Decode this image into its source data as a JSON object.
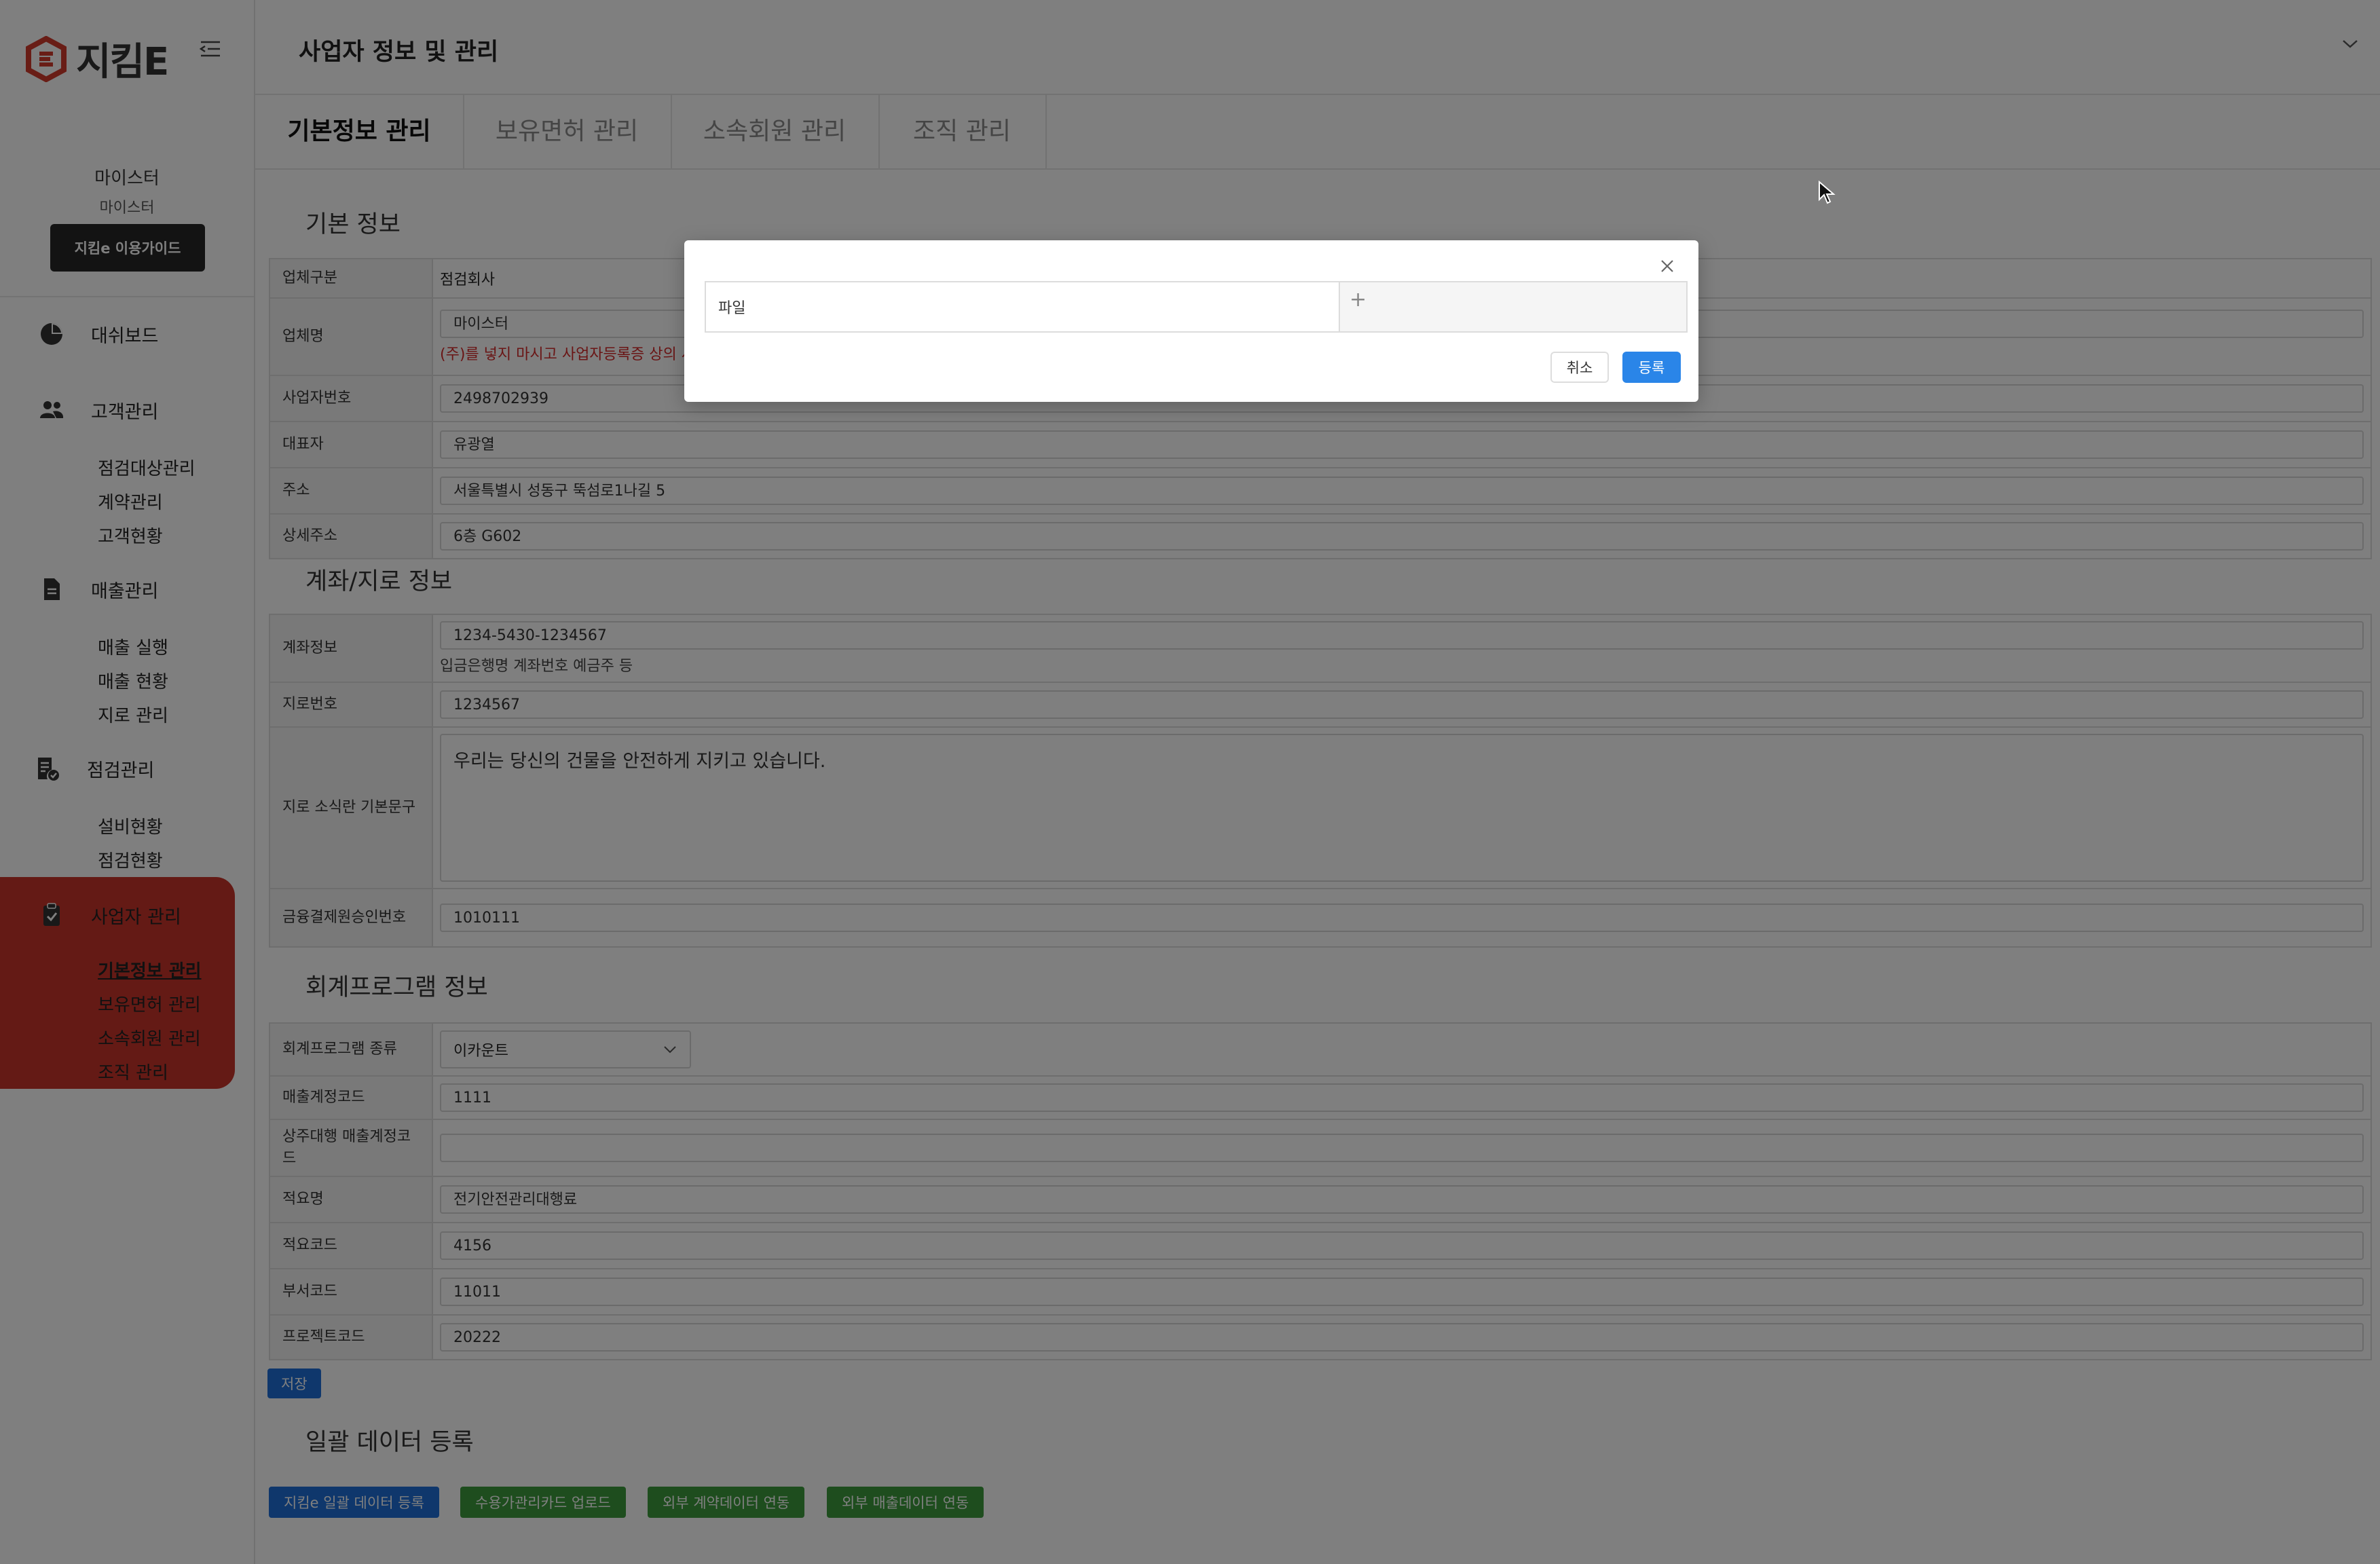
{
  "app": {
    "logo_text": "지킴E",
    "page_title": "사업자 정보 및 관리"
  },
  "sidebar": {
    "user_name": "마이스터",
    "user_role": "마이스터",
    "guide_button": "지킴e 이용가이드",
    "sections": [
      {
        "label": "대쉬보드",
        "icon": "pie-chart-icon",
        "items": []
      },
      {
        "label": "고객관리",
        "icon": "users-icon",
        "items": [
          "점검대상관리",
          "계약관리",
          "고객현황"
        ]
      },
      {
        "label": "매출관리",
        "icon": "document-icon",
        "items": [
          "매출 실행",
          "매출 현황",
          "지로 관리"
        ]
      },
      {
        "label": "점검관리",
        "icon": "checklist-icon",
        "items": [
          "설비현황",
          "점검현황"
        ]
      },
      {
        "label": "사업자 관리",
        "icon": "clipboard-icon",
        "items": [
          "기본정보 관리",
          "보유면허 관리",
          "소속회원 관리",
          "조직 관리"
        ]
      }
    ],
    "active_section": "사업자 관리",
    "active_item": "기본정보 관리"
  },
  "tabs": [
    "기본정보 관리",
    "보유면허 관리",
    "소속회원 관리",
    "조직 관리"
  ],
  "active_tab": "기본정보 관리",
  "basic_info": {
    "title": "기본 정보",
    "rows": [
      {
        "label": "업체구분",
        "value": "점검회사"
      },
      {
        "label": "업체명",
        "value": "마이스터",
        "note": "(주)를 넣지 마시고 사업자등록증 상의 사"
      },
      {
        "label": "사업자번호",
        "value": "2498702939"
      },
      {
        "label": "대표자",
        "value": "유광열"
      },
      {
        "label": "주소",
        "value": "서울특별시 성동구 뚝섬로1나길 5"
      },
      {
        "label": "상세주소",
        "value": "6층 G602"
      }
    ]
  },
  "account_info": {
    "title": "계좌/지로 정보",
    "account_label": "계좌정보",
    "account_value": "1234-5430-1234567",
    "account_note": "입금은행명 계좌번호 예금주 등",
    "giro_label": "지로번호",
    "giro_value": "1234567",
    "phrase_label": "지로 소식란 기본문구",
    "phrase_value": "우리는 당신의 건물을 안전하게 지키고 있습니다.",
    "approval_label": "금융결제원승인번호",
    "approval_value": "1010111"
  },
  "accounting_info": {
    "title": "회계프로그램 정보",
    "program_label": "회계프로그램 종류",
    "program_value": "이카운트",
    "rows": [
      {
        "label": "매출계정코드",
        "value": "1111"
      },
      {
        "label": "상주대행 매출계정코드",
        "value": ""
      },
      {
        "label": "적요명",
        "value": "전기안전관리대행료"
      },
      {
        "label": "적요코드",
        "value": "4156"
      },
      {
        "label": "부서코드",
        "value": "11011"
      },
      {
        "label": "프로젝트코드",
        "value": "20222"
      }
    ],
    "save_button": "저장"
  },
  "bulk": {
    "title": "일괄 데이터 등록",
    "buttons": [
      "지킴e 일괄 데이터 등록",
      "수용가관리카드 업로드",
      "외부 계약데이터 연동",
      "외부 매출데이터 연동"
    ]
  },
  "modal": {
    "file_label": "파일",
    "add_symbol": "+",
    "cancel_button": "취소",
    "submit_button": "등록"
  }
}
